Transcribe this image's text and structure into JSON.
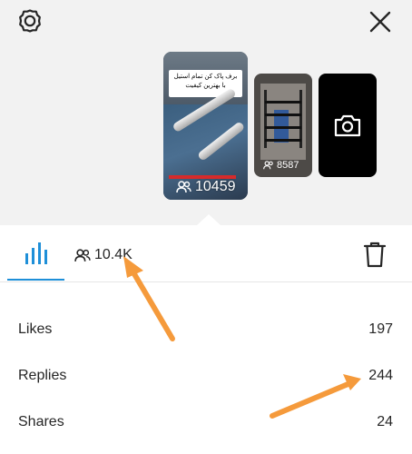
{
  "stories": {
    "main": {
      "caption_line1": "برف پاک کن تمام استیل",
      "caption_line2": "با بهترین کیفیت",
      "viewer_count": "10459"
    },
    "second": {
      "viewer_count": "8587"
    }
  },
  "tabs": {
    "viewers_count": "10.4K"
  },
  "stats": [
    {
      "label": "Likes",
      "value": "197"
    },
    {
      "label": "Replies",
      "value": "244"
    },
    {
      "label": "Shares",
      "value": "24"
    }
  ],
  "colors": {
    "accent": "#1e8fd8",
    "annotation_arrow": "#f59a3b"
  }
}
